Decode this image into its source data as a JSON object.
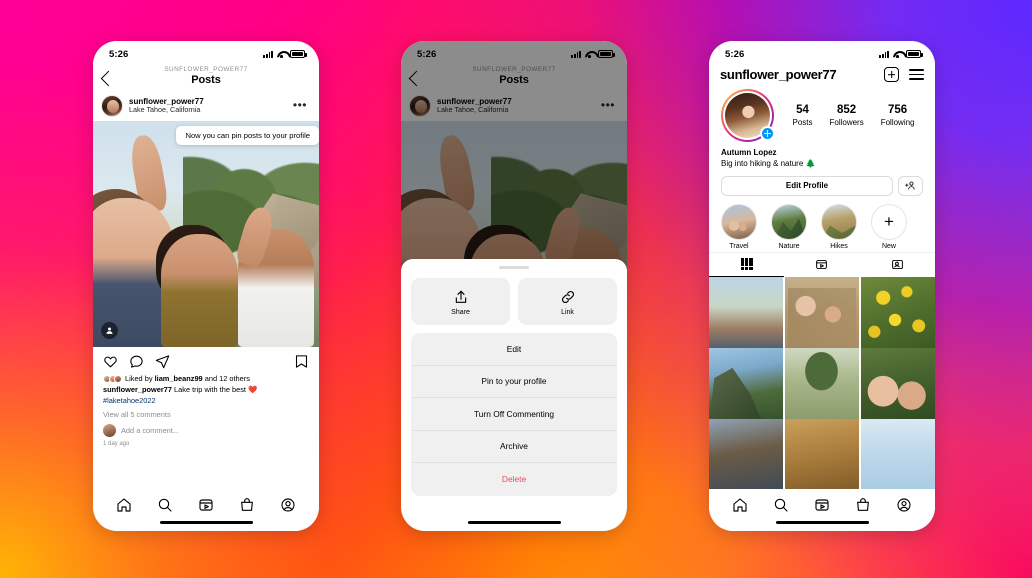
{
  "background": {
    "gradient_colors": [
      "#FF0090",
      "#FF1A4F",
      "#FF7A00",
      "#FFC000",
      "#5D28FF",
      "#9600E6"
    ]
  },
  "phone1": {
    "status": {
      "time": "5:26",
      "signal_icon": "cellular-signal-icon",
      "wifi_icon": "wifi-icon",
      "battery_icon": "battery-icon"
    },
    "nav": {
      "back_icon": "back-chevron-icon",
      "subtitle": "SUNFLOWER_POWER77",
      "title": "Posts"
    },
    "post": {
      "avatar": "user-avatar",
      "username": "sunflower_power77",
      "location": "Lake Tahoe, California",
      "more_icon": "more-options-icon",
      "tooltip": "Now you can pin posts to your profile",
      "tag_icon": "person-tag-icon",
      "actions": {
        "like": "heart-icon",
        "comment": "comment-icon",
        "share": "share-icon",
        "save": "bookmark-icon"
      },
      "likes_text_prefix": "Liked by ",
      "likes_user": "liam_beanz99",
      "likes_text_suffix": " and 12 others",
      "caption_user": "sunflower_power77",
      "caption_text": " Lake trip with the best ❤️",
      "caption_hashtag": "#laketahoe2022",
      "view_comments": "View all 5 comments",
      "add_comment_placeholder": "Add a comment...",
      "time_ago": "1 day ago"
    },
    "tabbar": [
      "home-icon",
      "search-icon",
      "reels-icon",
      "shop-icon",
      "profile-icon"
    ],
    "home_indicator": "home-indicator"
  },
  "phone2": {
    "status": {
      "time": "5:26",
      "signal_icon": "cellular-signal-icon",
      "wifi_icon": "wifi-icon",
      "battery_icon": "battery-icon"
    },
    "nav": {
      "back_icon": "back-chevron-icon",
      "subtitle": "SUNFLOWER_POWER77",
      "title": "Posts"
    },
    "post": {
      "username": "sunflower_power77",
      "location": "Lake Tahoe, California",
      "more_icon": "more-options-icon"
    },
    "sheet": {
      "grabber": "drag-handle",
      "tiles": [
        {
          "label": "Share",
          "icon": "share-up-icon"
        },
        {
          "label": "Link",
          "icon": "link-icon"
        }
      ],
      "rows": [
        {
          "label": "Edit",
          "danger": false
        },
        {
          "label": "Pin to your profile",
          "danger": false
        },
        {
          "label": "Turn Off Commenting",
          "danger": false
        },
        {
          "label": "Archive",
          "danger": false
        },
        {
          "label": "Delete",
          "danger": true
        }
      ],
      "danger_color": "#ed4956"
    },
    "home_indicator": "home-indicator"
  },
  "phone3": {
    "status": {
      "time": "5:26",
      "signal_icon": "cellular-signal-icon",
      "wifi_icon": "wifi-icon",
      "battery_icon": "battery-icon"
    },
    "header": {
      "username": "sunflower_power77",
      "add_icon": "add-post-icon",
      "menu_icon": "hamburger-menu-icon"
    },
    "avatar": {
      "name": "profile-avatar",
      "add_story_icon": "add-story-plus-icon",
      "add_color": "#0095f6"
    },
    "stats": [
      {
        "value": "54",
        "label": "Posts"
      },
      {
        "value": "852",
        "label": "Followers"
      },
      {
        "value": "756",
        "label": "Following"
      }
    ],
    "bio": {
      "name": "Autumn Lopez",
      "line": "Big into hiking & nature 🌲"
    },
    "buttons": {
      "edit_profile": "Edit Profile",
      "add_user_icon": "add-person-icon"
    },
    "highlights": [
      {
        "label": "Travel",
        "icon": "highlight-cover"
      },
      {
        "label": "Nature",
        "icon": "highlight-cover"
      },
      {
        "label": "Hikes",
        "icon": "highlight-cover"
      },
      {
        "label": "New",
        "icon": "plus-icon"
      }
    ],
    "tabs": [
      {
        "name": "grid-tab",
        "icon": "grid-icon",
        "active": true
      },
      {
        "name": "reels-tab",
        "icon": "reels-icon",
        "active": false
      },
      {
        "name": "tagged-tab",
        "icon": "tagged-icon",
        "active": false
      }
    ],
    "tabbar": [
      "home-icon",
      "search-icon",
      "reels-icon",
      "shop-icon",
      "profile-icon"
    ],
    "home_indicator": "home-indicator"
  }
}
